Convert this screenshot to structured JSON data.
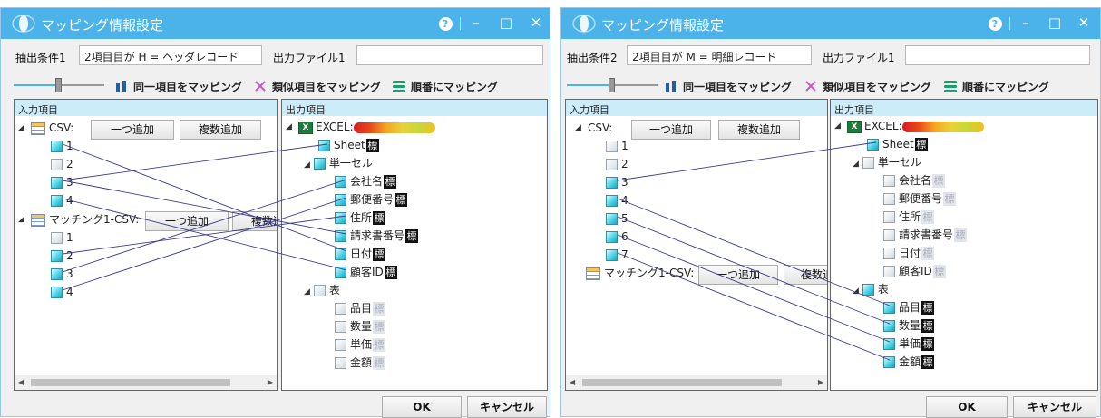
{
  "dialog1": {
    "title": "マッピング情報設定",
    "cond_label": "抽出条件1",
    "cond_value": "2項目目が H = ヘッダレコード",
    "out_label": "出力ファイル1",
    "out_value": "",
    "map_same": "同一項目をマッピング",
    "map_similar": "類似項目をマッピング",
    "map_order": "順番にマッピング",
    "input_header": "入力項目",
    "output_header": "出力項目",
    "csv_label": "CSV:",
    "add_one": "一つ追加",
    "add_multi": "複数追加",
    "csv_fields": [
      "1",
      "2",
      "3",
      "4"
    ],
    "matching_label": "マッチング1-CSV:",
    "add_one2": "一つ追加",
    "add_multi2": "複数追",
    "matching_fields": [
      "1",
      "2",
      "3",
      "4"
    ],
    "excel_label": "EXCEL:",
    "sheet": "Sheet",
    "single_cell": "単一セル",
    "cell_fields": [
      "会社名",
      "郵便番号",
      "住所",
      "請求書番号",
      "日付",
      "顧客ID"
    ],
    "table": "表",
    "table_fields": [
      "品目",
      "数量",
      "単価",
      "金額"
    ],
    "marker": "標",
    "ok": "OK",
    "cancel": "キャンセル"
  },
  "dialog2": {
    "title": "マッピング情報設定",
    "cond_label": "抽出条件2",
    "cond_value": "2項目目が M = 明細レコード",
    "out_label": "出力ファイル1",
    "out_value": "",
    "map_same": "同一項目をマッピング",
    "map_similar": "類似項目をマッピング",
    "map_order": "順番にマッピング",
    "input_header": "入力項目",
    "output_header": "出力項目",
    "csv_label": "CSV:",
    "add_one": "一つ追加",
    "add_multi": "複数追加",
    "csv_fields": [
      "1",
      "2",
      "3",
      "4",
      "5",
      "6",
      "7"
    ],
    "matching_label": "マッチング1-CSV:",
    "add_one2": "一つ追加",
    "add_multi2": "複数追",
    "excel_label": "EXCEL:",
    "sheet": "Sheet",
    "single_cell": "単一セル",
    "cell_fields": [
      "会社名",
      "郵便番号",
      "住所",
      "請求書番号",
      "日付",
      "顧客ID"
    ],
    "table": "表",
    "table_fields": [
      "品目",
      "数量",
      "単価",
      "金額"
    ],
    "marker": "標",
    "ok": "OK",
    "cancel": "キャンセル"
  },
  "colors": {
    "titlebar": "#4bb3ea",
    "panel_header": "#ccecfa",
    "map_line": "#3b3b8f",
    "accent": "#1aa6bf"
  }
}
